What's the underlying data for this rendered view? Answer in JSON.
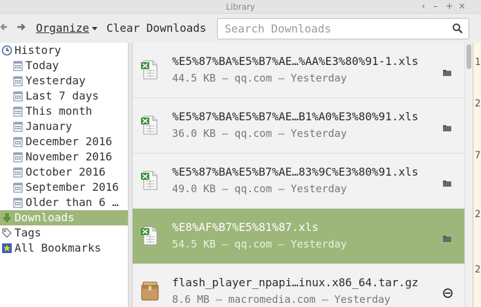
{
  "window": {
    "title": "Library",
    "controls": [
      "‹",
      "–",
      "+",
      "×"
    ]
  },
  "toolbar": {
    "back_icon": "back-arrow-icon",
    "forward_icon": "forward-arrow-icon",
    "organize_label": "Organize",
    "clear_downloads_label": "Clear Downloads"
  },
  "search": {
    "placeholder": "Search Downloads",
    "value": ""
  },
  "sidebar": {
    "items": [
      {
        "label": "History",
        "icon": "clock-icon",
        "indent": 0
      },
      {
        "label": "Today",
        "icon": "calendar-icon",
        "indent": 1
      },
      {
        "label": "Yesterday",
        "icon": "calendar-icon",
        "indent": 1
      },
      {
        "label": "Last 7 days",
        "icon": "calendar-icon",
        "indent": 1
      },
      {
        "label": "This month",
        "icon": "calendar-icon",
        "indent": 1
      },
      {
        "label": "January",
        "icon": "calendar-icon",
        "indent": 1
      },
      {
        "label": "December 2016",
        "icon": "calendar-icon",
        "indent": 1
      },
      {
        "label": "November 2016",
        "icon": "calendar-icon",
        "indent": 1
      },
      {
        "label": "October 2016",
        "icon": "calendar-icon",
        "indent": 1
      },
      {
        "label": "September 2016",
        "icon": "calendar-icon",
        "indent": 1
      },
      {
        "label": "Older than 6 …",
        "icon": "calendar-icon",
        "indent": 1
      },
      {
        "label": "Downloads",
        "icon": "download-icon",
        "indent": 0,
        "selected": true
      },
      {
        "label": "Tags",
        "icon": "tag-icon",
        "indent": 0
      },
      {
        "label": "All Bookmarks",
        "icon": "star-icon",
        "indent": 0
      }
    ]
  },
  "downloads": [
    {
      "name": "%E5%87%BA%E5%B7%AE…%AA%E3%80%91-1.xls",
      "meta": "44.5 KB — qq.com — Yesterday",
      "icon": "spreadsheet-icon",
      "action": "folder-icon"
    },
    {
      "name": "%E5%87%BA%E5%B7%AE…B1%A0%E3%80%91.xls",
      "meta": "36.0 KB — qq.com — Yesterday",
      "icon": "spreadsheet-icon",
      "action": "folder-icon"
    },
    {
      "name": "%E5%87%BA%E5%B7%AE…83%9C%E3%80%91.xls",
      "meta": "49.0 KB — qq.com — Yesterday",
      "icon": "spreadsheet-icon",
      "action": "folder-icon"
    },
    {
      "name": "%E8%AF%B7%E5%81%87.xls",
      "meta": "54.5 KB — qq.com — Yesterday",
      "icon": "spreadsheet-icon",
      "action": "folder-icon",
      "selected": true
    },
    {
      "name": "flash_player_npapi…inux.x86_64.tar.gz",
      "meta": "8.6 MB — macromedia.com — Yesterday",
      "icon": "package-icon",
      "action": "retry-icon"
    }
  ],
  "colors": {
    "selection": "#9db77a",
    "spreadsheet_green": "#3c8f3c"
  },
  "edge_chars": [
    "1",
    "2",
    "7",
    "2",
    "2"
  ]
}
